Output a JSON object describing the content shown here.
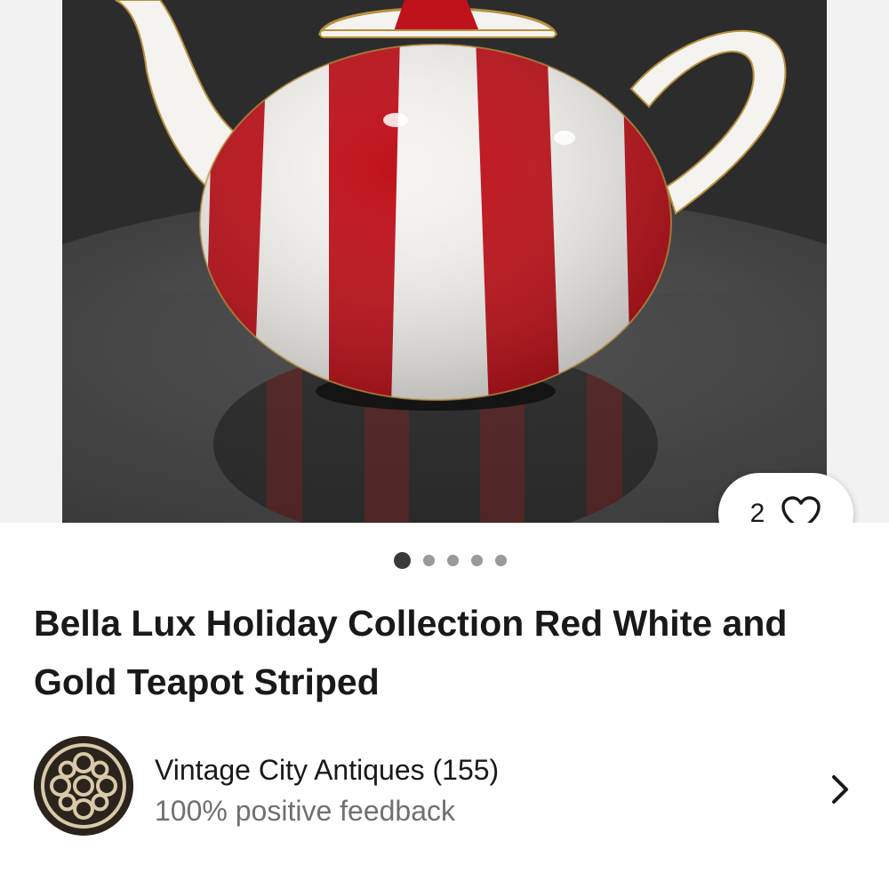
{
  "gallery": {
    "watch_count": "2",
    "icons": {
      "watch": "heart-icon"
    },
    "page_indicator": {
      "total": 5,
      "active": 1
    },
    "colors": {
      "stripe_red": "#c0121b",
      "porcelain_white": "#f5f3ef",
      "gold_trim": "#b8903e"
    }
  },
  "listing": {
    "title": "Bella Lux Holiday Collection Red White and Gold Teapot Striped"
  },
  "seller": {
    "name": "Vintage City Antiques (155)",
    "feedback": "100% positive feedback",
    "icons": {
      "chevron": "chevron-right-icon"
    }
  }
}
